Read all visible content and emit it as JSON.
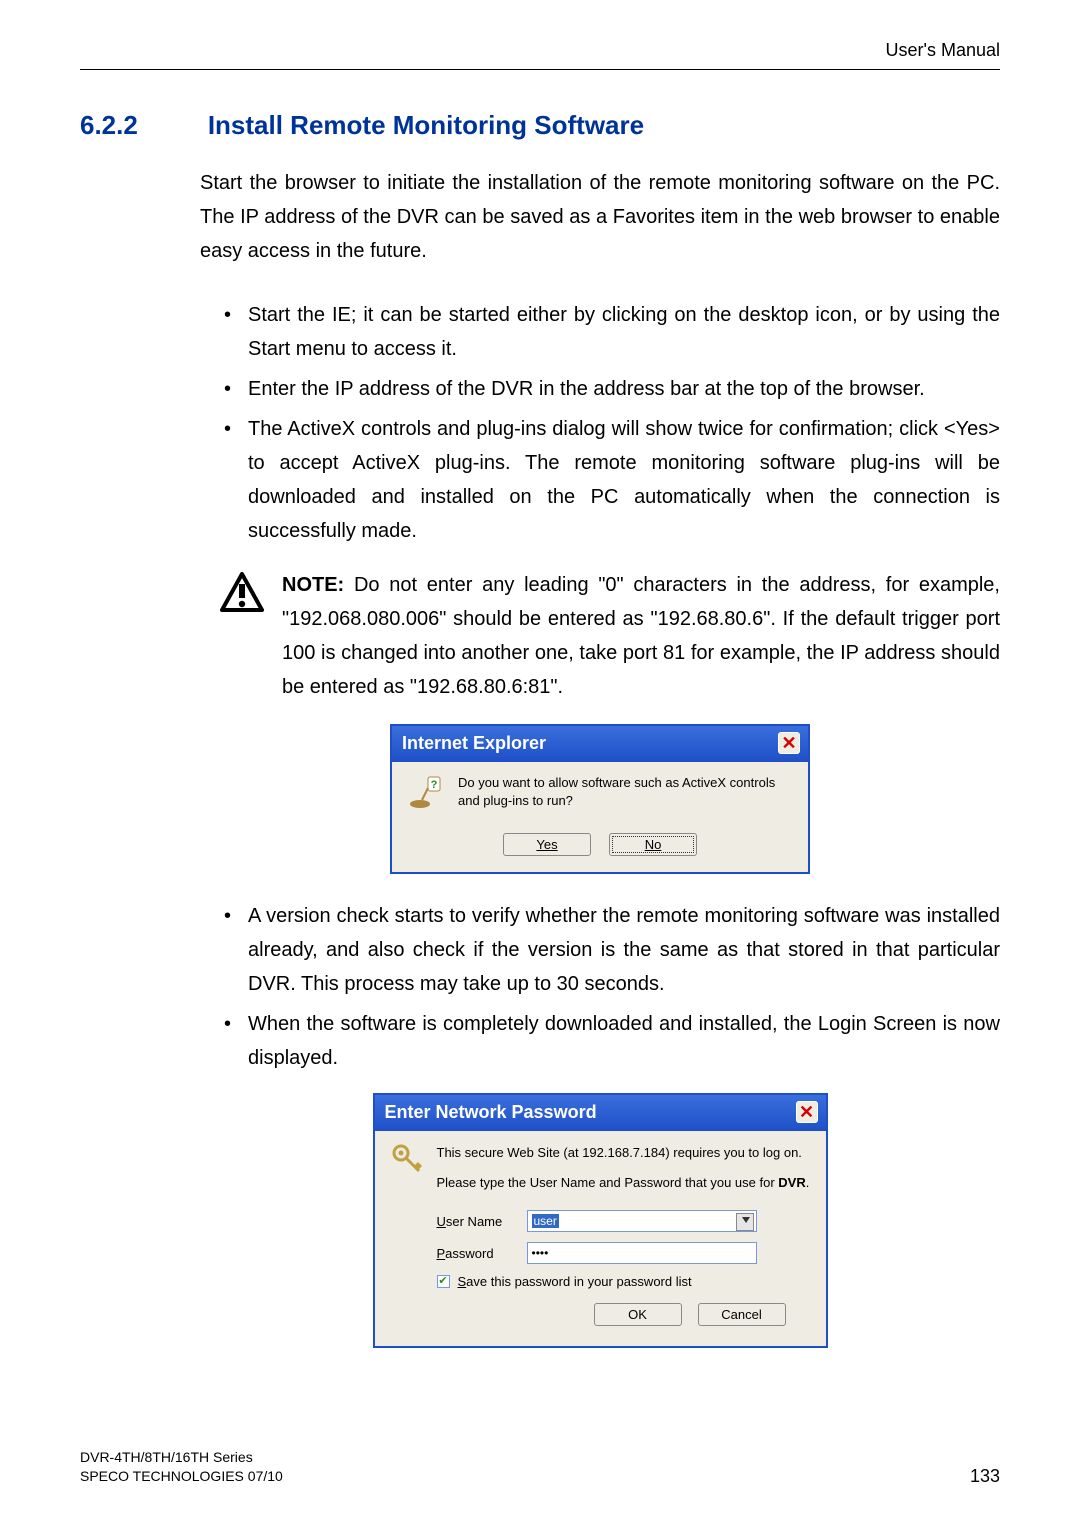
{
  "header": {
    "right": "User's Manual"
  },
  "section": {
    "number": "6.2.2",
    "title": "Install Remote Monitoring Software"
  },
  "intro": "Start the browser to initiate the installation of the remote monitoring software on the PC. The IP address of the DVR can be saved as a Favorites item in the web browser to enable easy access in the future.",
  "bullets_top": [
    "Start the IE; it can be started either by clicking on the desktop icon, or by using the Start menu to access it.",
    "Enter the IP address of the DVR in the address bar at the top of the browser.",
    "The ActiveX controls and plug-ins dialog will show twice for confirmation; click <Yes> to accept ActiveX plug-ins. The remote monitoring software plug-ins will be downloaded and installed on the PC automatically when the connection is successfully made."
  ],
  "note": {
    "label": "NOTE:",
    "text": "Do not enter any leading \"0\" characters in the address, for example, \"192.068.080.006\" should be entered as \"192.68.80.6\". If the default trigger port 100 is changed into another one, take port 81 for example, the IP address should be entered as \"192.68.80.6:81\"."
  },
  "dialog1": {
    "title": "Internet Explorer",
    "message": "Do you want to allow software such as ActiveX controls and plug-ins to run?",
    "yes": "Yes",
    "no": "No"
  },
  "bullets_bottom": [
    "A version check starts to verify whether the remote monitoring software was installed already, and also check if the version is the same as that stored in that particular DVR. This process may take up to 30 seconds.",
    "When the software is completely downloaded and installed, the Login Screen is now displayed."
  ],
  "dialog2": {
    "title": "Enter Network Password",
    "lead1": "This secure Web Site (at 192.168.7.184) requires you to log on.",
    "lead2_pre": "Please type the User Name and Password that you use for ",
    "lead2_bold": "DVR",
    "lead2_post": ".",
    "username_label_u": "U",
    "username_label_rest": "ser Name",
    "password_label_u": "P",
    "password_label_rest": "assword",
    "username_value": "user",
    "password_value": "••••",
    "save_pw_u": "S",
    "save_pw_rest": "ave this password in your password list",
    "ok": "OK",
    "cancel": "Cancel"
  },
  "footer": {
    "line1": "DVR-4TH/8TH/16TH Series",
    "line2": "SPECO TECHNOLOGIES 07/10",
    "page": "133"
  }
}
